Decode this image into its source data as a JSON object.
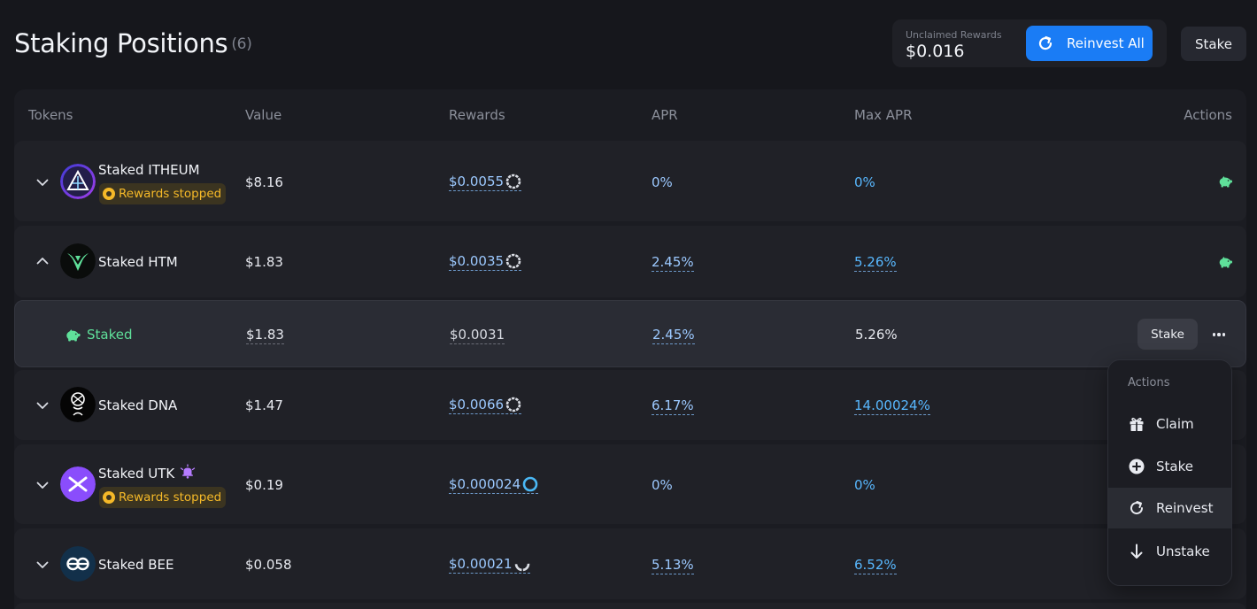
{
  "header": {
    "title": "Staking Positions",
    "count": "(6)",
    "unclaimed_label": "Unclaimed Rewards",
    "unclaimed_value": "$0.016",
    "reinvest_all_label": "Reinvest All",
    "stake_label": "Stake"
  },
  "table": {
    "columns": [
      "Tokens",
      "Value",
      "Rewards",
      "APR",
      "Max APR",
      "Actions"
    ],
    "rows": [
      {
        "name": "Staked ITHEUM",
        "badge": "Rewards stopped",
        "value": "$8.16",
        "rewards": "$0.0055",
        "apr": "0%",
        "max_apr": "0%"
      },
      {
        "name": "Staked HTM",
        "value": "$1.83",
        "rewards": "$0.0035",
        "apr": "2.45%",
        "max_apr": "5.26%"
      },
      {
        "name": "Staked DNA",
        "value": "$1.47",
        "rewards": "$0.0066",
        "apr": "6.17%",
        "max_apr": "14.00024%"
      },
      {
        "name": "Staked UTK",
        "badge": "Rewards stopped",
        "value": "$0.19",
        "rewards": "$0.000024",
        "apr": "0%",
        "max_apr": "0%"
      },
      {
        "name": "Staked BEE",
        "value": "$0.058",
        "rewards": "$0.00021",
        "apr": "5.13%",
        "max_apr": "6.52%"
      }
    ],
    "sub_row": {
      "label": "Staked",
      "value": "$1.83",
      "rewards": "$0.0031",
      "apr": "2.45%",
      "max_apr": "5.26%",
      "stake_label": "Stake"
    }
  },
  "menu": {
    "title": "Actions",
    "items": [
      {
        "label": "Claim",
        "icon": "gift-icon"
      },
      {
        "label": "Stake",
        "icon": "plus-circle-icon"
      },
      {
        "label": "Reinvest",
        "icon": "reinvest-icon"
      },
      {
        "label": "Unstake",
        "icon": "arrow-down-icon"
      }
    ]
  },
  "colors": {
    "accent": "#1a7cf5",
    "link": "#58b8ff",
    "staked_green": "#5fe09a",
    "warning": "#f5b928"
  }
}
